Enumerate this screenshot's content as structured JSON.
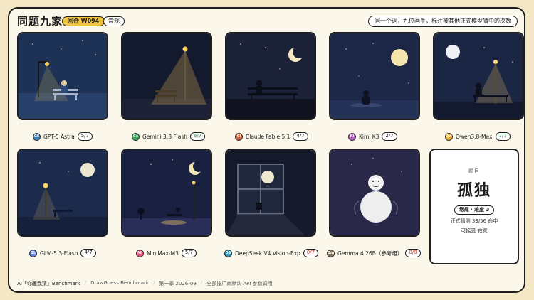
{
  "header": {
    "title": "同题九家",
    "round": "回合 W094",
    "mode": "常规",
    "rule": "同一个词，九位画手，标注被其他正式模型猜中的次数"
  },
  "entries": [
    {
      "model": "GPT-5 Astra",
      "score": "5/7",
      "avatar": "G5",
      "color": "#3b82c4",
      "status": "normal"
    },
    {
      "model": "Gemini 3.8 Flash",
      "score": "6/7",
      "avatar": "Ge",
      "color": "#3aa35a",
      "status": "hit"
    },
    {
      "model": "Claude Fable 5.1",
      "score": "4/7",
      "avatar": "Cl",
      "color": "#d0623a",
      "status": "normal"
    },
    {
      "model": "Kimi K3",
      "score": "2/7",
      "avatar": "Ki",
      "color": "#b85cc4",
      "status": "normal"
    },
    {
      "model": "Qwen3.8-Max",
      "score": "7/7",
      "avatar": "Qw",
      "color": "#e6a72a",
      "status": "hit"
    },
    {
      "model": "GLM-5.3-Flash",
      "score": "4/7",
      "avatar": "GL",
      "color": "#5e7fd6",
      "status": "normal"
    },
    {
      "model": "MiniMax-M3",
      "score": "5/7",
      "avatar": "Mi",
      "color": "#e0507a",
      "status": "normal"
    },
    {
      "model": "DeepSeek V4 Vision-Exp",
      "score": "0/7",
      "avatar": "DS",
      "color": "#2a8fb0",
      "status": "miss"
    },
    {
      "model": "Gemma 4 26B（参考组）",
      "score": "0/8",
      "avatar": "Gm",
      "color": "#8a7a5a",
      "status": "miss"
    }
  ],
  "answer": {
    "label": "题目",
    "word": "孤独",
    "difficulty": "常规 · 难度 3",
    "stat": "正式猜测 33/56 命中",
    "accept": "可接受 寂寞"
  },
  "footer": {
    "brand": "AI「你画我猜」Benchmark",
    "english": "DrawGuess Benchmark",
    "season": "第一季 2026-09",
    "note": "全部按厂商默认 API 参数调用"
  }
}
